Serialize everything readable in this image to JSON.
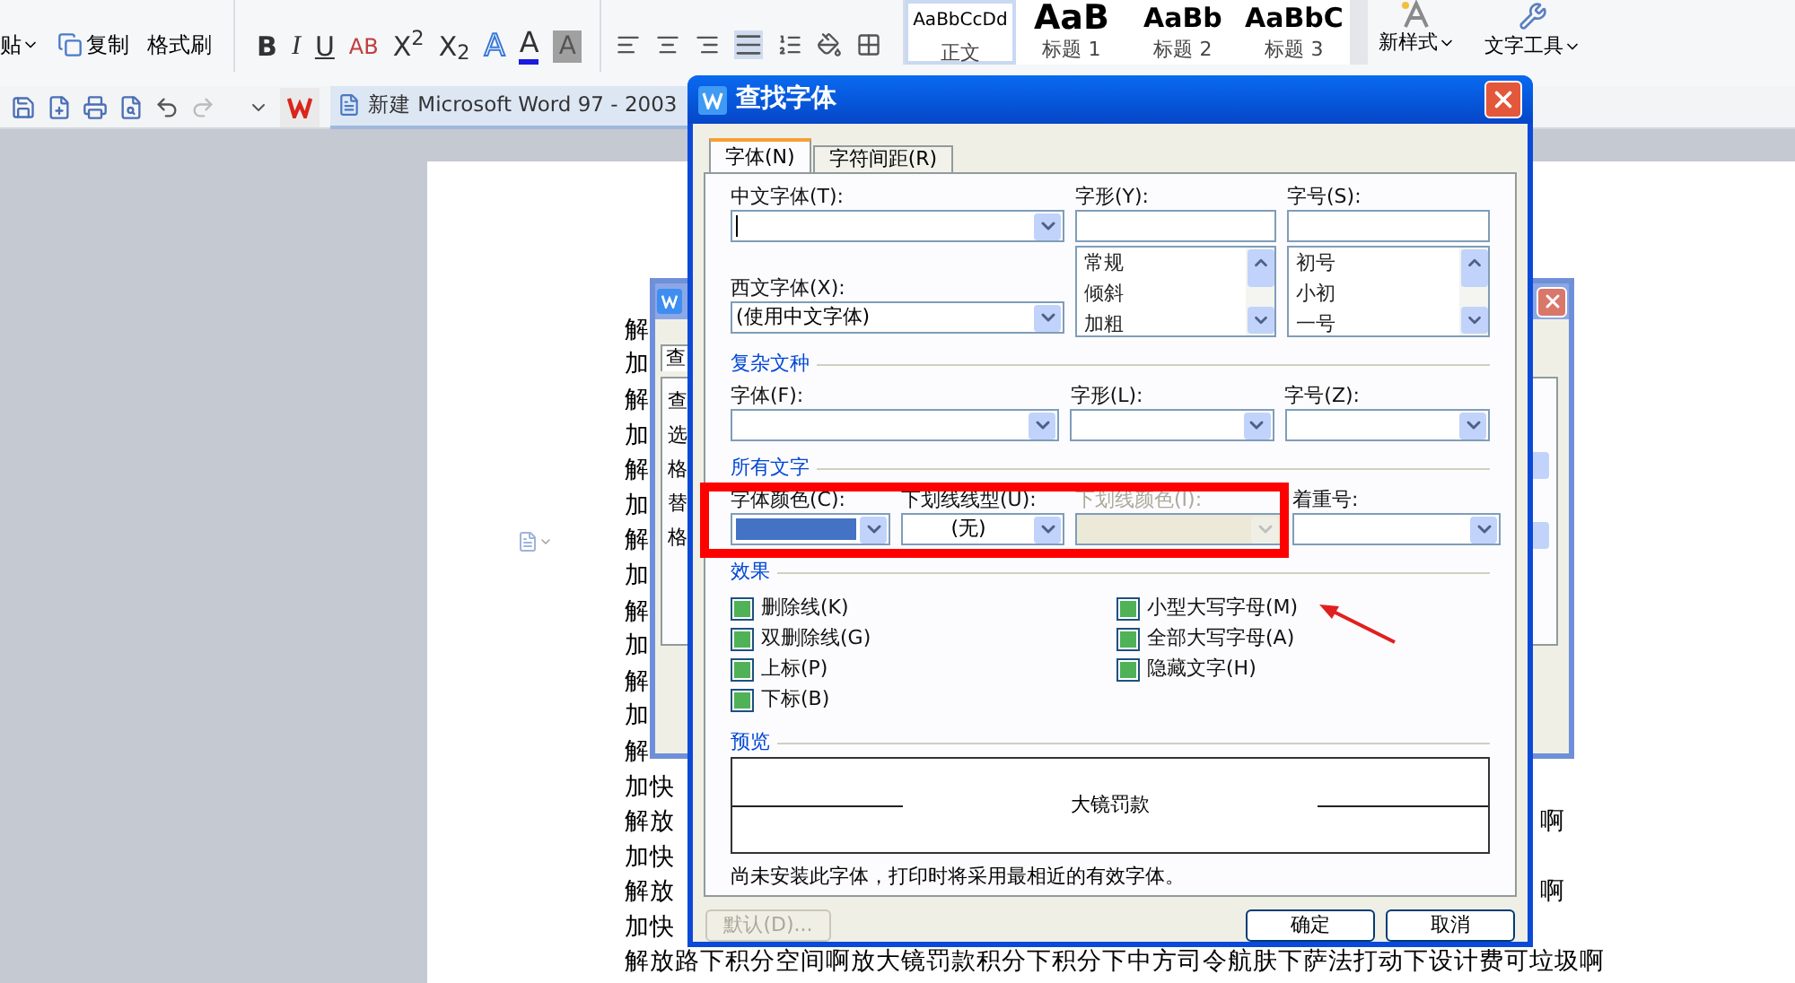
{
  "ribbon": {
    "paste": "贴",
    "copy": "复制",
    "format_painter": "格式刷",
    "format_buttons": [
      {
        "kind": "bold",
        "text": "B"
      },
      {
        "kind": "italic",
        "text": "I"
      },
      {
        "kind": "underline",
        "text": "U"
      },
      {
        "kind": "strike",
        "text": "AB"
      },
      {
        "kind": "plain",
        "text": "X$^{2}$"
      },
      {
        "kind": "plain",
        "text": "X$_{2}$"
      },
      {
        "kind": "outline",
        "text": "A"
      },
      {
        "kind": "color",
        "text": "A"
      },
      {
        "kind": "shade",
        "text": "A"
      }
    ],
    "styles": [
      {
        "preview": "AaBbCcDd",
        "label": "正文",
        "selected": true,
        "kind": "small"
      },
      {
        "preview": "AaB",
        "label": "标题 1",
        "selected": false,
        "kind": "large"
      },
      {
        "preview": "AaBb",
        "label": "标题 2",
        "selected": false,
        "kind": "medium"
      },
      {
        "preview": "AaBbC",
        "label": "标题 3",
        "selected": false,
        "kind": "medium"
      }
    ],
    "new_style": "新样式",
    "text_tools": "文字工具"
  },
  "document_tab": "新建 Microsoft Word 97 - 2003",
  "document_lines": [
    {
      "text": "解"
    },
    {
      "text": "加"
    },
    {
      "text": "解"
    },
    {
      "text": "加"
    },
    {
      "text": "解"
    },
    {
      "text": "加"
    },
    {
      "text": "解"
    },
    {
      "text": "加"
    },
    {
      "text": "解"
    },
    {
      "text": "加"
    },
    {
      "text": "解"
    },
    {
      "text": "加"
    },
    {
      "text": "解"
    },
    {
      "text": "加快"
    },
    {
      "text": "解放",
      "tail": "啊"
    },
    {
      "text": "加快"
    },
    {
      "text": "解放",
      "tail": "啊"
    },
    {
      "text": "加快"
    },
    {
      "text": "解放路下积分空间啊放大镜罚款积分下积分下中方司令航肤下萨法打动下设计费可垃圾啊"
    }
  ],
  "background_dialog": {
    "tab": "查",
    "labels": [
      "查",
      "选",
      "格",
      "替",
      "格"
    ]
  },
  "dialog": {
    "title": "查找字体",
    "tabs": [
      {
        "label": "字体(N)",
        "selected": true
      },
      {
        "label": "字符间距(R)",
        "selected": false
      }
    ],
    "chinese_font": {
      "label": "中文字体(T):"
    },
    "style": {
      "label": "字形(Y):",
      "options": [
        "常规",
        "倾斜",
        "加粗"
      ]
    },
    "size": {
      "label": "字号(S):",
      "options": [
        "初号",
        "小初",
        "一号"
      ]
    },
    "western_font": {
      "label": "西文字体(X):",
      "value": "(使用中文字体)"
    },
    "complex": {
      "title": "复杂文种",
      "fields": [
        "字体(F):",
        "字形(L):",
        "字号(Z):"
      ]
    },
    "all_text": {
      "title": "所有文字",
      "font_color": {
        "label": "字体颜色(C):",
        "color": "#4472c4"
      },
      "underline_style": {
        "label": "下划线线型(U):",
        "value": "(无)"
      },
      "underline_color": {
        "label": "下划线颜色(I):",
        "disabled": true
      },
      "emphasis": {
        "label": "着重号:"
      }
    },
    "effects": {
      "title": "效果",
      "left": [
        {
          "label": "删除线(K)",
          "indeterminate": true
        },
        {
          "label": "双删除线(G)",
          "indeterminate": true
        },
        {
          "label": "上标(P)",
          "indeterminate": true
        },
        {
          "label": "下标(B)",
          "indeterminate": true
        }
      ],
      "right": [
        {
          "label": "小型大写字母(M)",
          "indeterminate": true
        },
        {
          "label": "全部大写字母(A)",
          "indeterminate": true
        },
        {
          "label": "隐藏文字(H)",
          "indeterminate": true
        }
      ]
    },
    "preview": {
      "title": "预览",
      "sample": "大镜罚款",
      "note": "尚未安装此字体，打印时将采用最相近的有效字体。"
    },
    "buttons": {
      "default": {
        "label": "默认(D)...",
        "disabled": true
      },
      "ok": "确定",
      "cancel": "取消"
    }
  }
}
